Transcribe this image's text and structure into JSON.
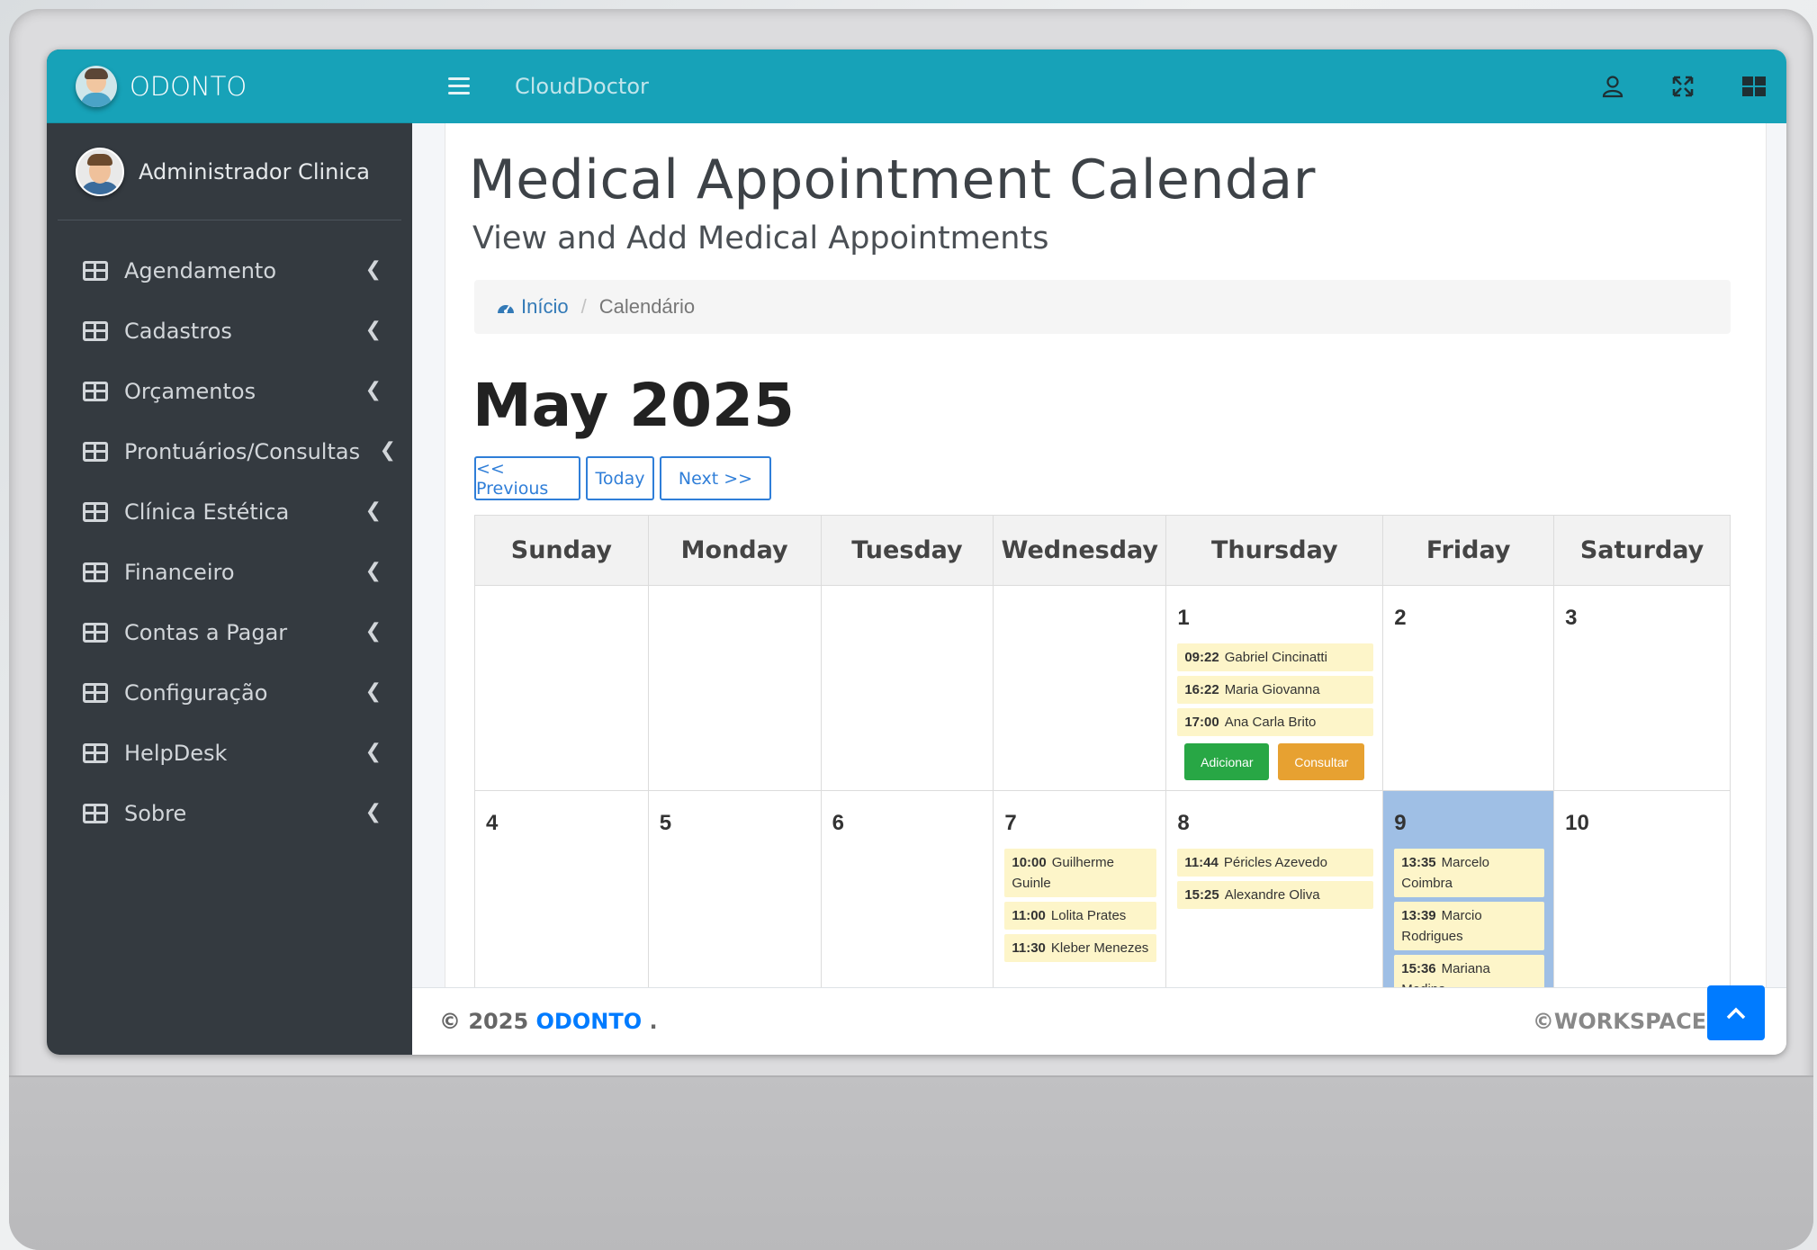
{
  "brand": {
    "name": "ODONTO"
  },
  "user": {
    "name": "Administrador Clinica"
  },
  "sidebar": {
    "items": [
      {
        "label": "Agendamento"
      },
      {
        "label": "Cadastros"
      },
      {
        "label": "Orçamentos"
      },
      {
        "label": "Prontuários/Consultas"
      },
      {
        "label": "Clínica Estética"
      },
      {
        "label": "Financeiro"
      },
      {
        "label": "Contas a Pagar"
      },
      {
        "label": "Configuração"
      },
      {
        "label": "HelpDesk"
      },
      {
        "label": "Sobre"
      }
    ]
  },
  "header": {
    "title": "CloudDoctor"
  },
  "page": {
    "title": "Medical Appointment Calendar",
    "subtitle": "View and Add Medical Appointments"
  },
  "breadcrumb": {
    "home": "Início",
    "current": "Calendário"
  },
  "calendar": {
    "month_label": "May 2025",
    "nav": {
      "previous": "<< Previous",
      "today": "Today",
      "next": "Next >>"
    },
    "weekdays": [
      "Sunday",
      "Monday",
      "Tuesday",
      "Wednesday",
      "Thursday",
      "Friday",
      "Saturday"
    ],
    "week1": {
      "d1": "1",
      "d2": "2",
      "d3": "3",
      "d1_appts": [
        {
          "time": "09:22",
          "name": "Gabriel Cincinatti"
        },
        {
          "time": "16:22",
          "name": "Maria Giovanna"
        },
        {
          "time": "17:00",
          "name": "Ana Carla Brito"
        }
      ],
      "add_label": "Adicionar",
      "consult_label": "Consultar"
    },
    "week2": {
      "d4": "4",
      "d5": "5",
      "d6": "6",
      "d7": "7",
      "d8": "8",
      "d9": "9",
      "d10": "10",
      "d7_appts": [
        {
          "time": "10:00",
          "name": "Guilherme Guinle"
        },
        {
          "time": "11:00",
          "name": "Lolita Prates"
        },
        {
          "time": "11:30",
          "name": "Kleber Menezes"
        }
      ],
      "d8_appts": [
        {
          "time": "11:44",
          "name": "Péricles Azevedo"
        },
        {
          "time": "15:25",
          "name": "Alexandre Oliva"
        }
      ],
      "d9_appts": [
        {
          "time": "13:35",
          "name": "Marcelo Coimbra"
        },
        {
          "time": "13:39",
          "name": "Marcio Rodrigues"
        },
        {
          "time": "15:36",
          "name": "Mariana Medina"
        }
      ]
    }
  },
  "footer": {
    "copyright": "© 2025",
    "brand": "ODONTO",
    "dot": ".",
    "right": "©WORKSPACE se"
  },
  "colors": {
    "primary": "#17a2b8",
    "sidebar": "#343a40",
    "link": "#007bff",
    "today": "#9fbfe5",
    "appointment": "#fdf5c9",
    "add": "#28a745",
    "consult": "#e7a131"
  },
  "icons": {
    "menu": "hamburger-icon",
    "user": "user-icon",
    "fullscreen": "expand-icon",
    "apps": "grid-icon",
    "nav": "table-icon",
    "chevron": "chevron-left-icon",
    "home": "dashboard-icon",
    "scroll": "chevron-up-icon"
  }
}
